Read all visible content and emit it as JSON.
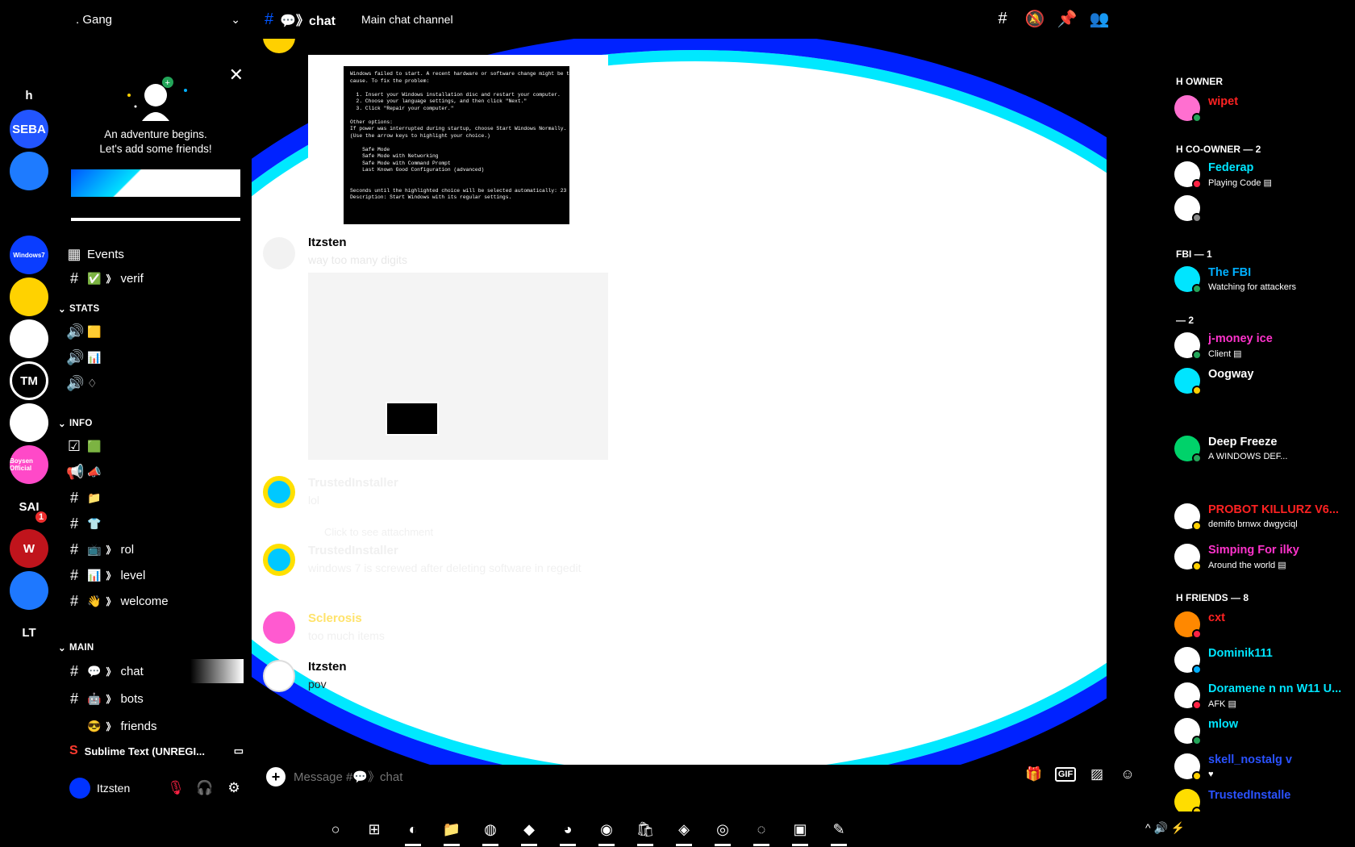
{
  "server": {
    "name": ". Gang"
  },
  "server_rail": [
    {
      "name": "rail-item",
      "label": "h",
      "color": "#000000"
    },
    {
      "name": "server-seba",
      "label": "SEBA",
      "color": "#2255ff"
    },
    {
      "name": "server-globe",
      "label": "",
      "color": "#1e7bff"
    },
    {
      "name": "server-emoji",
      "label": "",
      "color": "#000000"
    },
    {
      "name": "server-windows7",
      "label": "Windows7",
      "color": "#0a3dff"
    },
    {
      "name": "server-cat",
      "label": "",
      "color": "#ffd200"
    },
    {
      "name": "server-white",
      "label": "",
      "color": "#ffffff"
    },
    {
      "name": "server-tm",
      "label": "TM",
      "color": "#000000"
    },
    {
      "name": "server-yellow",
      "label": "",
      "color": "#ffffff"
    },
    {
      "name": "server-boysen",
      "label": "Boysen Official",
      "color": "#ff49c8"
    },
    {
      "name": "server-sai",
      "label": "SAI",
      "color": "#000000"
    },
    {
      "name": "server-wings",
      "label": "W",
      "color": "#c0141c"
    },
    {
      "name": "server-cross",
      "label": "",
      "color": "#1e78ff"
    },
    {
      "name": "server-lt",
      "label": "LT",
      "color": "#000000"
    },
    {
      "name": "server-dots",
      "label": "",
      "color": "#000000"
    }
  ],
  "invite": {
    "line1": "An adventure begins.",
    "line2": "Let's add some friends!",
    "close": "✕"
  },
  "sidebar": {
    "events_label": "Events",
    "verify_label": "verif",
    "categories": {
      "stats": "STATS",
      "info": "INFO",
      "main": "MAIN"
    },
    "info_channels": [
      {
        "emoji": "📺",
        "label": "rol"
      },
      {
        "emoji": "📊",
        "label": "level"
      },
      {
        "emoji": "👋",
        "label": "welcome"
      }
    ],
    "main_channels": [
      {
        "emoji": "💬",
        "label": "chat"
      },
      {
        "emoji": "🤖",
        "label": "bots"
      },
      {
        "emoji": "😎",
        "label": "friends"
      }
    ],
    "activity": "Sublime Text (UNREGI...",
    "user": "Itzsten"
  },
  "header": {
    "channel": "💬》chat",
    "topic": "Main chat channel"
  },
  "messages": {
    "bsod_text": "Windows failed to start. A recent hardware or software change might be the\ncause. To fix the problem:\n\n  1. Insert your Windows installation disc and restart your computer.\n  2. Choose your language settings, and then click \"Next.\"\n  3. Click \"Repair your computer.\"\n\nOther options:\nIf power was interrupted during startup, choose Start Windows Normally.\n(Use the arrow keys to highlight your choice.)\n\n    Safe Mode\n    Safe Mode with Networking\n    Safe Mode with Command Prompt\n    Last Known Good Configuration (advanced)\n\n\nSeconds until the highlighted choice will be selected automatically: 23\nDescription: Start Windows with its regular settings.",
    "m1_author": "Itzsten",
    "m1_text": "way too many digits",
    "m2_author": "TrustedInstaller",
    "m2_text": "lol",
    "m3_reply": "Click to see attachment",
    "m3_author": "TrustedInstaller",
    "m3_text": "windows 7 is screwed after deleting software in regedit",
    "m4_author": "Sclerosis",
    "m4_text": "too much items",
    "m5_author": "Itzsten",
    "m5_text": "pov"
  },
  "composer": {
    "placeholder": "Message #💬》chat",
    "gif_label": "GIF"
  },
  "members": {
    "roles": [
      "H OWNER",
      "H CO-OWNER — 2",
      "FBI — 1",
      "— 2",
      "H FRIENDS — 8"
    ],
    "list": [
      {
        "name": "wipet",
        "sub": "",
        "color": "#ff2222",
        "status": "#23a559",
        "av": "#ff6fd0"
      },
      {
        "name": "Federap",
        "sub": "Playing Code ▤",
        "color": "#00e5ff",
        "status": "#ff2244",
        "av": "#ffffff"
      },
      {
        "name": "",
        "sub": "",
        "color": "#ffffff",
        "status": "#888888",
        "av": "#ffffff"
      },
      {
        "name": "The FBI",
        "sub": "Watching for attackers",
        "color": "#00b0ff",
        "status": "#23a559",
        "av": "#00e5ff"
      },
      {
        "name": "j-money ice",
        "sub": "Client ▤",
        "color": "#ff33cc",
        "status": "#23a559",
        "av": "#ffffff"
      },
      {
        "name": "Oogway",
        "sub": "",
        "color": "#ffffff",
        "status": "#ffd000",
        "av": "#00e5ff"
      },
      {
        "name": "Deep Freeze",
        "sub": "A WINDOWS DEF...",
        "color": "#ffffff",
        "status": "#23a559",
        "av": "#00d26a"
      },
      {
        "name": "PROBOT KILLURZ V6...",
        "sub": "demifo brnwx dwgyciql",
        "color": "#ff2222",
        "status": "#ffd000",
        "av": "#ffffff"
      },
      {
        "name": "Simping For ilky",
        "sub": "Around the world ▤",
        "color": "#ff33cc",
        "status": "#ffd000",
        "av": "#ffffff"
      },
      {
        "name": "cxt",
        "sub": "",
        "color": "#ff2222",
        "status": "#ff2244",
        "av": "#ff8800"
      },
      {
        "name": "Dominik111",
        "sub": "",
        "color": "#00e5ff",
        "status": "#00b0ff",
        "av": "#ffffff"
      },
      {
        "name": "Doramene n nn W11 U...",
        "sub": "AFK ▤",
        "color": "#00e5ff",
        "status": "#ff2244",
        "av": "#ffffff"
      },
      {
        "name": "mlow",
        "sub": "",
        "color": "#00e5ff",
        "status": "#23a559",
        "av": "#ffffff"
      },
      {
        "name": "skell_nostalg v",
        "sub": "♥",
        "color": "#2a52ff",
        "status": "#ffd000",
        "av": "#ffffff"
      },
      {
        "name": "TrustedInstalle",
        "sub": "",
        "color": "#2a52ff",
        "status": "#ffd000",
        "av": "#ffdd00"
      }
    ]
  },
  "taskbar": {
    "apps": [
      "○",
      "⊞",
      "◐",
      "📁",
      "◍",
      "◆",
      "◕",
      "◉",
      "🛍",
      "◈",
      "◎",
      "◌",
      "▣",
      "✎"
    ],
    "tray": "^ 🔊 ⚡"
  }
}
